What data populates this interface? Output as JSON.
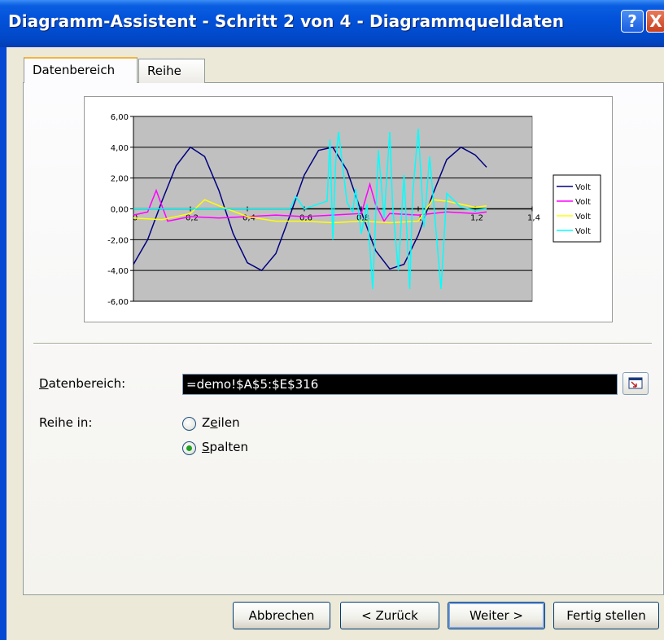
{
  "window": {
    "title": "Diagramm-Assistent - Schritt 2 von 4 - Diagrammquelldaten",
    "help_label": "?",
    "close_label": "X"
  },
  "tabs": [
    {
      "label": "Datenbereich",
      "active": true
    },
    {
      "label": "Reihe",
      "active": false
    }
  ],
  "chart_data": {
    "type": "line",
    "y_ticks": [
      "6,00",
      "4,00",
      "2,00",
      "0,00",
      "-2,00",
      "-4,00",
      "-6,00"
    ],
    "x_ticks": [
      "0",
      "0,2",
      "0,4",
      "0,6",
      "0,8",
      "1",
      "1,2",
      "1,4"
    ],
    "xlim": [
      0,
      1.4
    ],
    "ylim": [
      -6,
      6
    ],
    "plot_background": "#c0c0c0",
    "grid": true,
    "legend_position": "right",
    "series": [
      {
        "name": "Volt",
        "color": "#000080",
        "x": [
          0,
          0.05,
          0.1,
          0.15,
          0.2,
          0.25,
          0.3,
          0.35,
          0.4,
          0.45,
          0.5,
          0.55,
          0.6,
          0.65,
          0.7,
          0.75,
          0.8,
          0.85,
          0.9,
          0.95,
          1.0,
          1.05,
          1.1,
          1.15,
          1.2,
          1.24
        ],
        "values": [
          -3.6,
          -2.0,
          0.5,
          2.8,
          4.0,
          3.4,
          1.2,
          -1.6,
          -3.5,
          -4.0,
          -2.9,
          -0.4,
          2.2,
          3.8,
          4.0,
          2.5,
          -0.2,
          -2.7,
          -3.9,
          -3.6,
          -1.7,
          0.9,
          3.2,
          4.0,
          3.5,
          2.7
        ]
      },
      {
        "name": "Volt",
        "color": "#ff00ff",
        "x": [
          0,
          0.05,
          0.08,
          0.1,
          0.12,
          0.2,
          0.3,
          0.4,
          0.5,
          0.6,
          0.7,
          0.8,
          0.83,
          0.85,
          0.88,
          0.9,
          1.0,
          1.1,
          1.2,
          1.24
        ],
        "values": [
          -0.4,
          -0.2,
          1.2,
          0.2,
          -0.8,
          -0.5,
          -0.6,
          -0.5,
          -0.4,
          -0.5,
          -0.4,
          -0.3,
          1.6,
          0.3,
          -0.8,
          -0.3,
          -0.4,
          -0.2,
          -0.3,
          -0.2
        ]
      },
      {
        "name": "Volt",
        "color": "#ffff00",
        "x": [
          0,
          0.1,
          0.2,
          0.25,
          0.3,
          0.4,
          0.5,
          0.6,
          0.7,
          0.8,
          0.9,
          1.0,
          1.05,
          1.1,
          1.2,
          1.24
        ],
        "values": [
          -0.6,
          -0.7,
          -0.3,
          0.6,
          0.2,
          -0.5,
          -0.8,
          -0.8,
          -0.9,
          -0.8,
          -0.9,
          -0.8,
          0.6,
          0.5,
          0.1,
          0.2
        ]
      },
      {
        "name": "Volt",
        "color": "#00ffff",
        "x": [
          0,
          0.2,
          0.4,
          0.55,
          0.57,
          0.6,
          0.68,
          0.69,
          0.7,
          0.71,
          0.72,
          0.75,
          0.77,
          0.78,
          0.8,
          0.82,
          0.84,
          0.86,
          0.88,
          0.9,
          0.91,
          0.93,
          0.95,
          0.97,
          0.98,
          1.0,
          1.02,
          1.04,
          1.08,
          1.1,
          1.15,
          1.2,
          1.24
        ],
        "values": [
          0,
          0,
          0,
          0,
          0.8,
          0,
          0.5,
          4.5,
          -2.0,
          3.0,
          5.0,
          0.4,
          -0.2,
          1.3,
          -1.6,
          0.3,
          -5.2,
          3.8,
          -0.6,
          5.0,
          0.2,
          -4.0,
          2.2,
          -5.2,
          0.8,
          5.2,
          -1.2,
          3.4,
          -5.2,
          1.0,
          0.1,
          -0.1,
          0
        ]
      }
    ]
  },
  "form": {
    "range_label": "Datenbereich:",
    "range_value": "=demo!$A$5:$E$316",
    "series_in_label": "Reihe in:",
    "radio_rows": "Zeilen",
    "radio_columns": "Spalten",
    "selected": "Spalten"
  },
  "buttons": {
    "cancel": "Abbrechen",
    "back": "< Zurück",
    "next": "Weiter >",
    "finish": "Fertig stellen"
  }
}
